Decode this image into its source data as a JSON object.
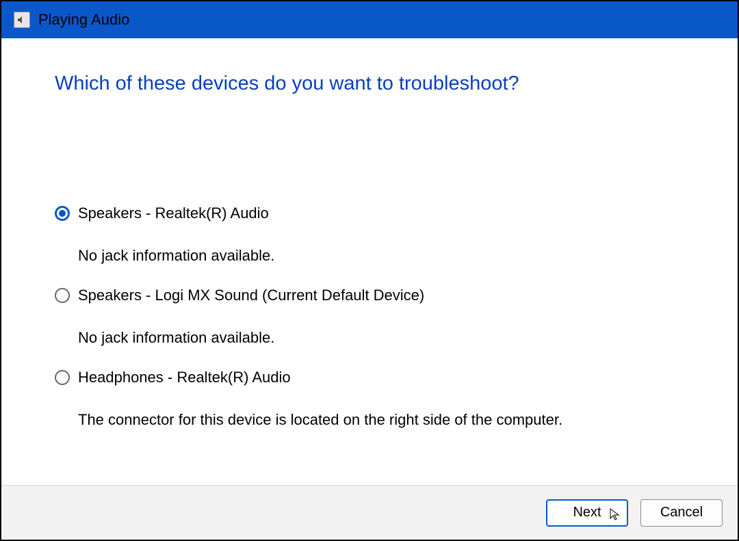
{
  "titlebar": {
    "title": "Playing Audio"
  },
  "content": {
    "heading": "Which of these devices do you want to troubleshoot?"
  },
  "devices": [
    {
      "label": "Speakers - Realtek(R) Audio",
      "sub": "No jack information available.",
      "selected": true
    },
    {
      "label": "Speakers - Logi MX Sound (Current Default Device)",
      "sub": "No jack information available.",
      "selected": false
    },
    {
      "label": "Headphones - Realtek(R) Audio",
      "sub": "The connector for this device is located on the right side of the computer.",
      "selected": false
    }
  ],
  "footer": {
    "next": "Next",
    "cancel": "Cancel"
  }
}
